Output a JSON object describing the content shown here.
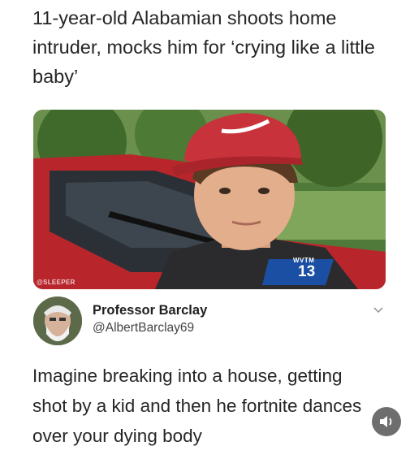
{
  "headline": "11-year-old Alabamian shoots home intruder, mocks him for ‘crying like a little baby’",
  "photo": {
    "channel_label": "WVTM",
    "channel_number": "13",
    "watermark": "@SLEEPER"
  },
  "tweet": {
    "author_name": "Professor Barclay",
    "author_handle": "@AlbertBarclay69",
    "text": "Imagine breaking into a house, getting shot by a kid and then he fortnite dances over your dying body"
  },
  "icons": {
    "chevron": "chevron-down-icon",
    "sound": "speaker-icon"
  },
  "colors": {
    "cap_red": "#c8323a",
    "car_red": "#b8262c",
    "sound_button": "#6e6e6e"
  }
}
